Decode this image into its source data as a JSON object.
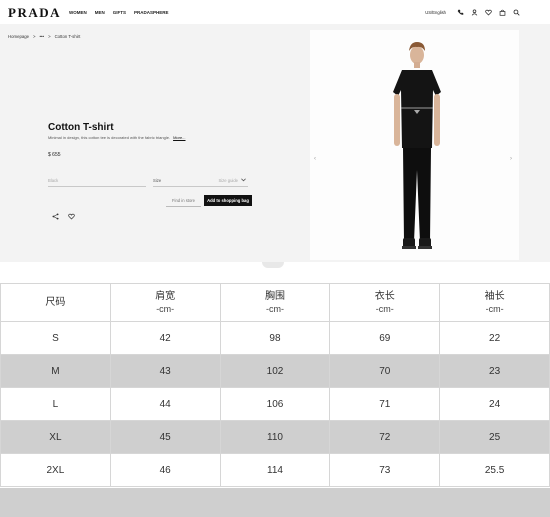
{
  "header": {
    "logo": "PRADA",
    "nav": [
      "WOMEN",
      "MEN",
      "GIFTS",
      "PRADASPHERE"
    ],
    "language": "US/English",
    "icons": [
      "phone-icon",
      "user-icon",
      "heart-icon",
      "bag-icon",
      "search-icon"
    ]
  },
  "breadcrumb": {
    "home": "Homepage",
    "sep1": ">",
    "ellipsis": "•••",
    "sep2": ">",
    "current": "Cotton T-shirt"
  },
  "product": {
    "title": "Cotton T-shirt",
    "description": "Minimal in design, this cotton tee is decorated with the fabric triangle.",
    "more_label": "More...",
    "price": "$ 655",
    "color_placeholder": "Black",
    "size_label": "Size",
    "size_placeholder": "Size guide",
    "find_in_store": "Find in store",
    "add_to_bag": "Add to shopping bag"
  },
  "size_table": {
    "headers": [
      {
        "label": "尺码",
        "unit": ""
      },
      {
        "label": "肩宽",
        "unit": "-cm-"
      },
      {
        "label": "胸围",
        "unit": "-cm-"
      },
      {
        "label": "衣长",
        "unit": "-cm-"
      },
      {
        "label": "袖长",
        "unit": "-cm-"
      }
    ],
    "rows": [
      [
        "S",
        "42",
        "98",
        "69",
        "22"
      ],
      [
        "M",
        "43",
        "102",
        "70",
        "23"
      ],
      [
        "L",
        "44",
        "106",
        "71",
        "24"
      ],
      [
        "XL",
        "45",
        "110",
        "72",
        "25"
      ],
      [
        "2XL",
        "46",
        "114",
        "73",
        "25.5"
      ]
    ]
  },
  "colors": {
    "accent": "#111111",
    "panel_bg": "#f3f3f3",
    "row_gray": "#cfcfcf"
  }
}
